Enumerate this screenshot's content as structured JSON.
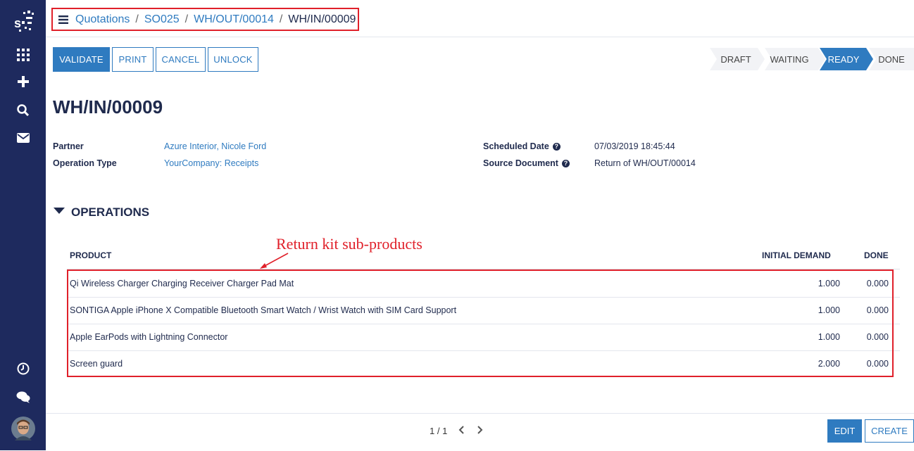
{
  "breadcrumb": [
    "Quotations",
    "SO025",
    "WH/OUT/00014",
    "WH/IN/00009"
  ],
  "actions": {
    "validate": "VALIDATE",
    "print": "PRINT",
    "cancel": "CANCEL",
    "unlock": "UNLOCK"
  },
  "statuses": [
    "DRAFT",
    "WAITING",
    "READY",
    "DONE"
  ],
  "active_status": "READY",
  "record": {
    "title": "WH/IN/00009",
    "partner_label": "Partner",
    "partner": "Azure Interior, Nicole Ford",
    "optype_label": "Operation Type",
    "optype": "YourCompany: Receipts",
    "scheduled_label": "Scheduled Date",
    "scheduled": "07/03/2019 18:45:44",
    "source_label": "Source Document",
    "source": "Return of WH/OUT/00014"
  },
  "operations": {
    "title": "OPERATIONS",
    "headers": {
      "product": "PRODUCT",
      "initial_demand": "INITIAL DEMAND",
      "done": "DONE"
    },
    "rows": [
      {
        "product": "Qi Wireless Charger Charging Receiver Charger Pad Mat",
        "initial_demand": "1.000",
        "done": "0.000"
      },
      {
        "product": "SONTIGA Apple iPhone X Compatible Bluetooth Smart Watch / Wrist Watch with SIM Card Support",
        "initial_demand": "1.000",
        "done": "0.000"
      },
      {
        "product": "Apple EarPods with Lightning Connector",
        "initial_demand": "1.000",
        "done": "0.000"
      },
      {
        "product": "Screen guard",
        "initial_demand": "2.000",
        "done": "0.000"
      }
    ]
  },
  "annotation": "Return kit sub-products",
  "pager": "1 / 1",
  "footer": {
    "edit": "EDIT",
    "create": "CREATE"
  },
  "colors": {
    "sidebar": "#1e2a5e",
    "accent": "#2f7bc0",
    "annotation": "#e0202a"
  }
}
